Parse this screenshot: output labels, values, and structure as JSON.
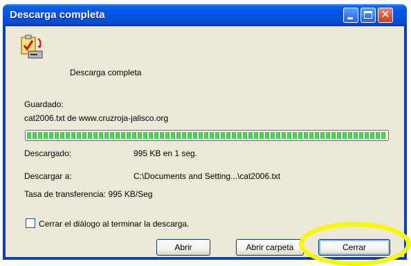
{
  "window": {
    "title": "Descarga completa"
  },
  "header": {
    "status": "Descarga completa"
  },
  "saved": {
    "label": "Guardado:",
    "source": "cat2006.txt de www.cruzroja-jalisco.org"
  },
  "progress": {
    "percent": 100
  },
  "details": {
    "downloaded_label": "Descargado:",
    "downloaded_value": "995 KB en 1 seg.",
    "destination_label": "Descargar a:",
    "destination_value": "C:\\Documents and Setting...\\cat2006.txt",
    "rate_text": "Tasa de transferencia: 995 KB/Seg"
  },
  "options": {
    "close_when_done": "Cerrar el diálogo al terminar la descarga."
  },
  "buttons": {
    "open": "Abrir",
    "open_folder": "Abrir carpeta",
    "close": "Cerrar"
  },
  "colors": {
    "titlebar": "#0554e3",
    "dialog_bg": "#ece9d8",
    "progress": "#31c33a",
    "highlight": "#f8f800"
  }
}
